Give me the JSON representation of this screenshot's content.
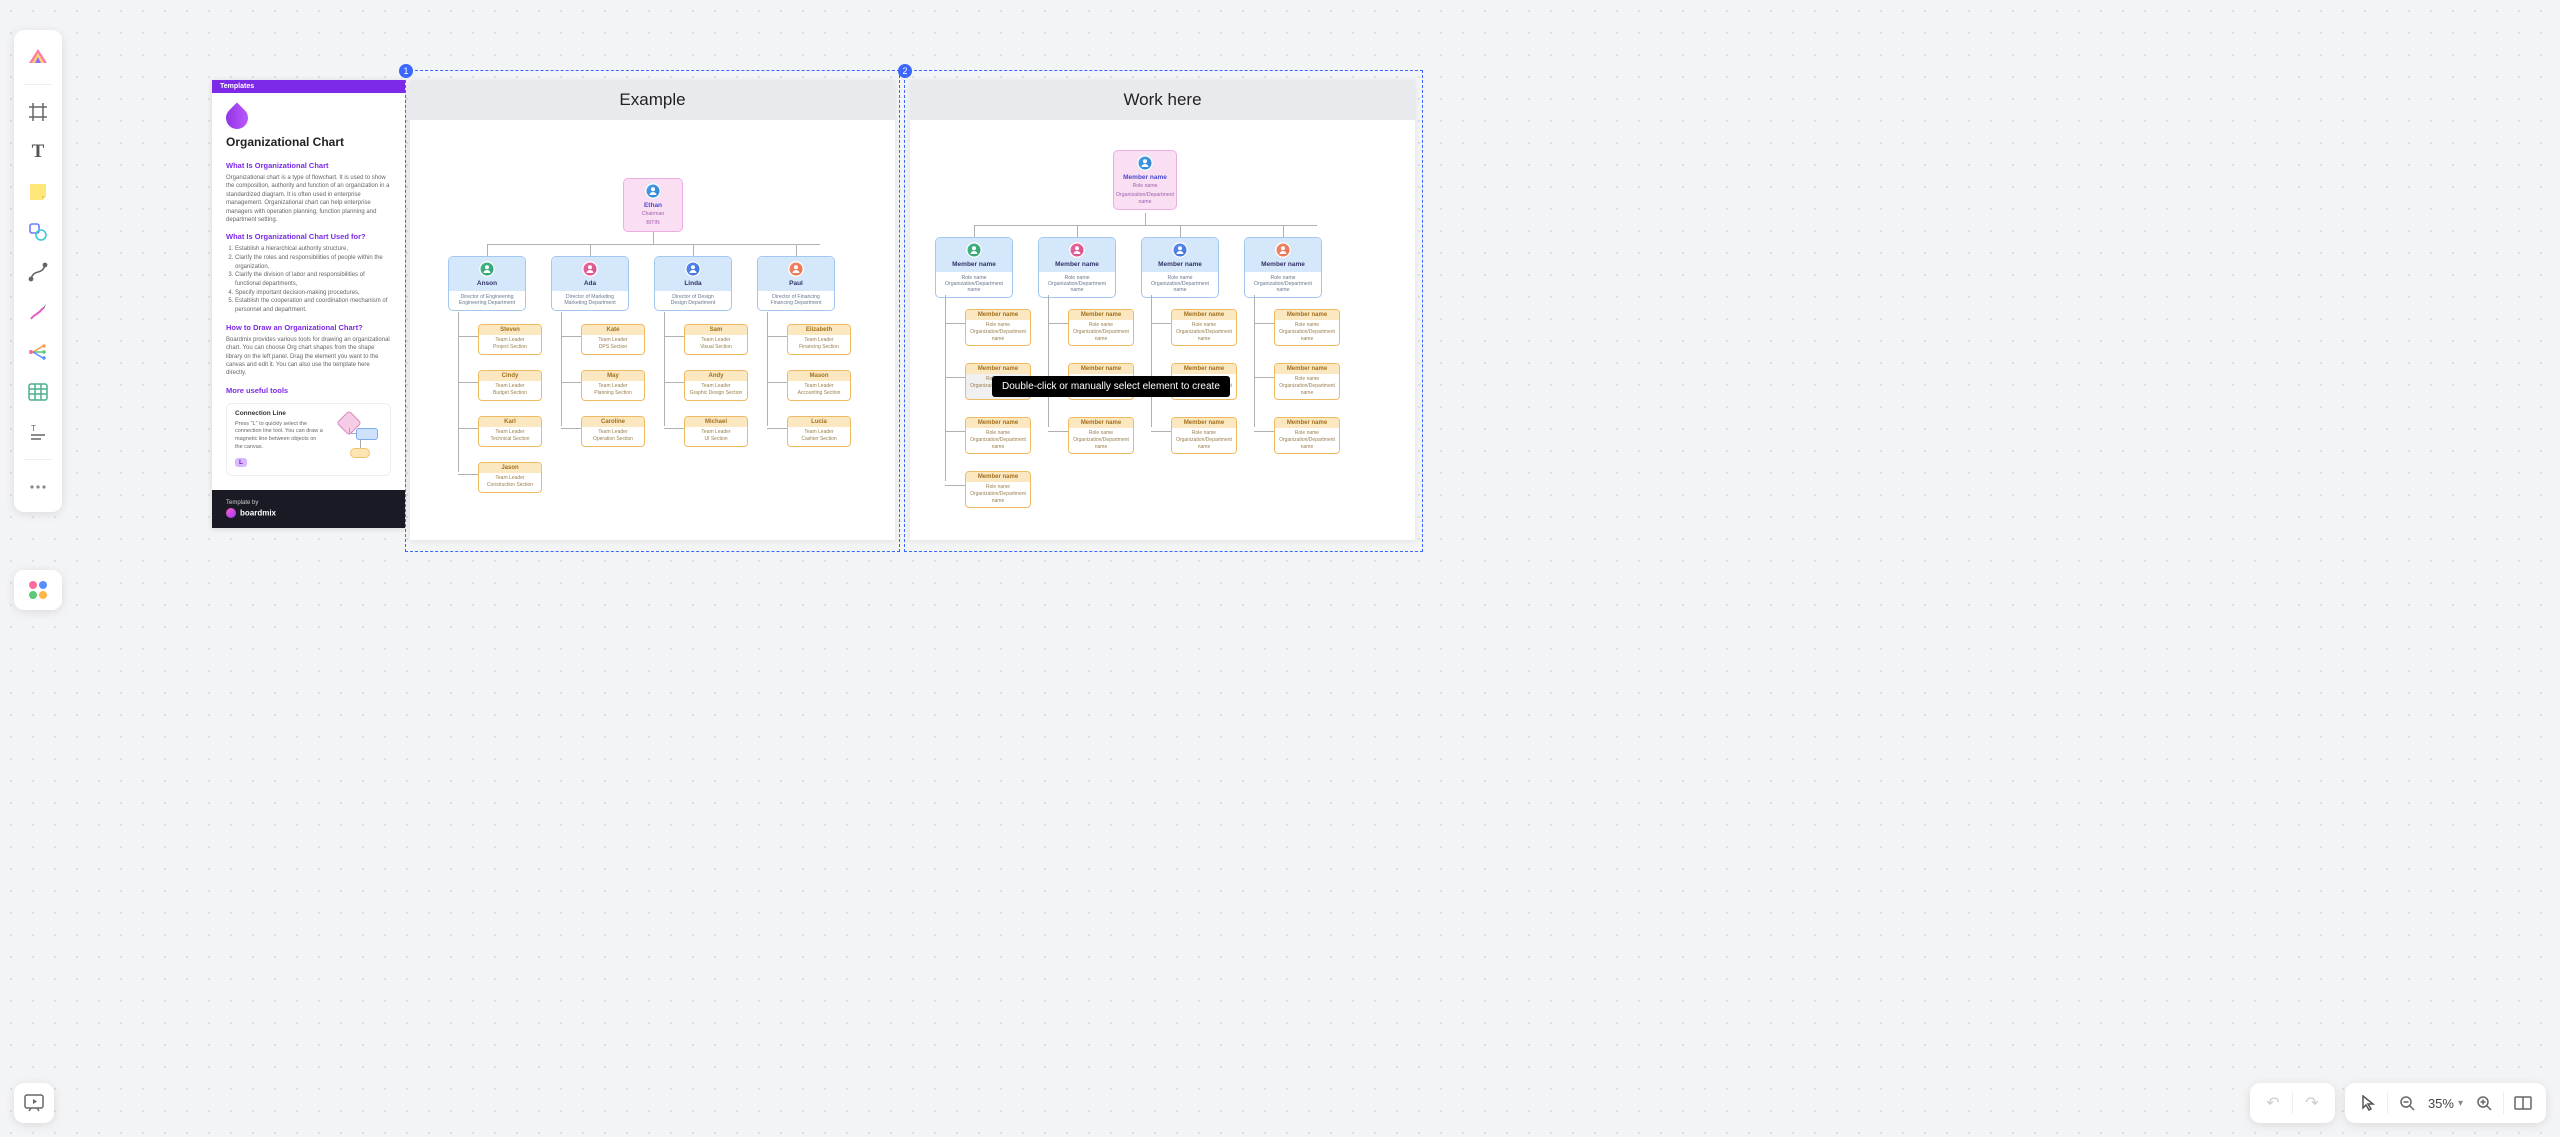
{
  "toolbar": {
    "icons": [
      "logo",
      "frame",
      "text",
      "sticky",
      "shapes",
      "connector",
      "pen",
      "mind",
      "table",
      "content",
      "more"
    ]
  },
  "bottom": {
    "zoom": "35%"
  },
  "selection": {
    "badge1": "1",
    "badge2": "2"
  },
  "template_panel": {
    "header": "Templates",
    "title": "Organizational Chart",
    "h1": "What Is Organizational Chart",
    "p1": "Organizational chart is a type of flowchart. It is used to show the composition, authority and function of an organization in a standardized diagram. It is often used in enterprise management. Organizational chart can help enterprise managers with operation planning, function planning and department setting.",
    "h2": "What Is Organizational Chart Used for?",
    "ol": [
      "Establish a hierarchical authority structure,",
      "Clarify the roles and responsibilities of people within the organization,",
      "Clarify the division of labor and responsibilities of functional departments,",
      "Specify important decision-making procedures,",
      "Establish the cooperation and coordination mechanism of personnel and department."
    ],
    "h3": "How to Draw an Organizational Chart?",
    "p3": "Boardmix provides various tools for drawing an organizational chart. You can choose Org chart shapes from the shape library on the left panel. Drag the element you want to the canvas and edit it. You can also use the template here directly.",
    "h4": "More useful tools",
    "tools_h": "Connection Line",
    "tools_p": "Press \"L\" to quickly select the connection line tool. You can draw a magnetic line between objects on the canvas.",
    "tools_key": "L",
    "footer_label": "Template by",
    "footer_brand": "boardmix"
  },
  "example": {
    "heading": "Example",
    "top": {
      "name": "Ethan",
      "role": "Chairman",
      "dept": "BITIN"
    },
    "dirs": [
      {
        "name": "Anson",
        "role": "Director of Engineering",
        "dept": "Engineering Department",
        "av": 1
      },
      {
        "name": "Ada",
        "role": "Director of Marketing",
        "dept": "Marketing Department",
        "av": 2
      },
      {
        "name": "Linda",
        "role": "Director of Design",
        "dept": "Design Department",
        "av": 3
      },
      {
        "name": "Paul",
        "role": "Director of Financing",
        "dept": "Financing Department",
        "av": 4
      }
    ],
    "leafs": [
      [
        {
          "name": "Steven",
          "role": "Team Leader",
          "section": "Project Section"
        },
        {
          "name": "Cindy",
          "role": "Team Leader",
          "section": "Budget Section"
        },
        {
          "name": "Karl",
          "role": "Team Leader",
          "section": "Technical Section"
        },
        {
          "name": "Jason",
          "role": "Team Leader",
          "section": "Construction Section"
        }
      ],
      [
        {
          "name": "Kate",
          "role": "Team Leader",
          "section": "DPS Section"
        },
        {
          "name": "May",
          "role": "Team Leader",
          "section": "Planning Section"
        },
        {
          "name": "Caroline",
          "role": "Team Leader",
          "section": "Operation Section"
        }
      ],
      [
        {
          "name": "Sam",
          "role": "Team Leader",
          "section": "Visual Section"
        },
        {
          "name": "Andy",
          "role": "Team Leader",
          "section": "Graphic Design Section"
        },
        {
          "name": "Michael",
          "role": "Team Leader",
          "section": "UI Section"
        }
      ],
      [
        {
          "name": "Elizabeth",
          "role": "Team Leader",
          "section": "Financing Section"
        },
        {
          "name": "Mason",
          "role": "Team Leader",
          "section": "Accounting Section"
        },
        {
          "name": "Lucia",
          "role": "Team Leader",
          "section": "Cashier Section"
        }
      ]
    ]
  },
  "work": {
    "heading": "Work here",
    "top": {
      "name": "Member name",
      "role": "Role name",
      "dept": "Organization/Department name"
    },
    "dir": {
      "name": "Member name",
      "role": "Role name",
      "dept": "Organization/Department name"
    },
    "leaf": {
      "name": "Member name",
      "role": "Role name",
      "dept": "Organization/Department name"
    },
    "col_counts": [
      4,
      3,
      3,
      3
    ],
    "avatars": [
      1,
      2,
      3,
      4
    ]
  },
  "tooltip": "Double-click or manually select element to create"
}
